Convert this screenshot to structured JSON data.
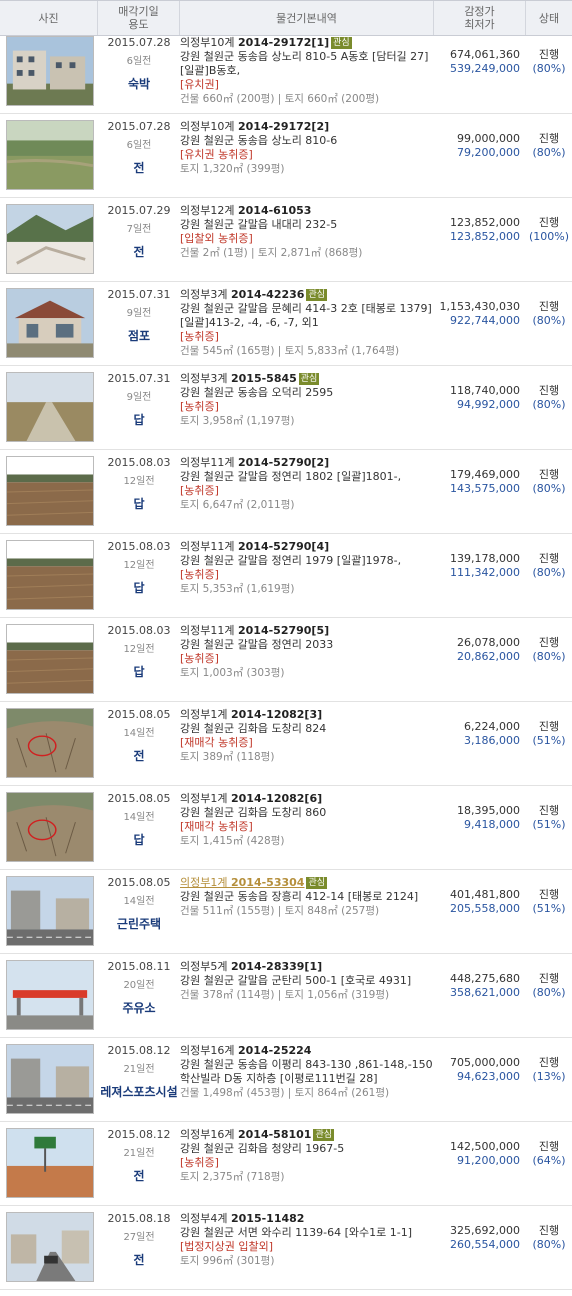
{
  "header": {
    "photo": "사진",
    "date_use": [
      "매각기일",
      "용도"
    ],
    "info": "물건기본내역",
    "price": [
      "감정가",
      "최저가"
    ],
    "status": "상태"
  },
  "rows": [
    {
      "date": "2015.07.28",
      "ago": "6일전",
      "use": "숙박",
      "court": "의정부10계",
      "case": "2014-29172[1]",
      "tag": "관심",
      "addr": "강원 철원군 동송읍 상노리 810-5 A동호 [담터길 27] [일괄]B동호,",
      "note": "[유치권]",
      "area": "건물 660㎡ (200평) | 토지 660㎡ (200평)",
      "appraisal": "674,061,360",
      "minimum": "539,249,000",
      "status": "진행",
      "pct": "(80%)",
      "img": "building"
    },
    {
      "date": "2015.07.28",
      "ago": "6일전",
      "use": "전",
      "court": "의정부10계",
      "case": "2014-29172[2]",
      "tag": "",
      "addr": "강원 철원군 동송읍 상노리 810-6",
      "note": "[유치권   농취증]",
      "area": "토지 1,320㎡ (399평)",
      "appraisal": "99,000,000",
      "minimum": "79,200,000",
      "status": "진행",
      "pct": "(80%)",
      "img": "field"
    },
    {
      "date": "2015.07.29",
      "ago": "7일전",
      "use": "전",
      "court": "의정부12계",
      "case": "2014-61053",
      "tag": "",
      "addr": "강원 철원군 갈말읍 내대리 232-5",
      "note": "[입찰외   농취증]",
      "area": "건물 2㎡ (1평) | 토지 2,871㎡ (868평)",
      "appraisal": "123,852,000",
      "minimum": "123,852,000",
      "status": "진행",
      "pct": "(100%)",
      "img": "snow"
    },
    {
      "date": "2015.07.31",
      "ago": "9일전",
      "use": "점포",
      "court": "의정부3계",
      "case": "2014-42236",
      "tag": "관심",
      "addr": "강원 철원군 갈말읍 문혜리 414-3 2호 [태봉로 1379] [일괄]413-2, -4, -6, -7, 외1",
      "note": "[농취증]",
      "area": "건물 545㎡ (165평) | 토지 5,833㎡ (1,764평)",
      "appraisal": "1,153,430,030",
      "minimum": "922,744,000",
      "status": "진행",
      "pct": "(80%)",
      "img": "shop"
    },
    {
      "date": "2015.07.31",
      "ago": "9일전",
      "use": "답",
      "court": "의정부3계",
      "case": "2015-5845",
      "tag": "관심",
      "addr": "강원 철원군 동송읍 오덕리 2595",
      "note": "[농취증]",
      "area": "토지 3,958㎡ (1,197평)",
      "appraisal": "118,740,000",
      "minimum": "94,992,000",
      "status": "진행",
      "pct": "(80%)",
      "img": "road"
    },
    {
      "date": "2015.08.03",
      "ago": "12일전",
      "use": "답",
      "court": "의정부11계",
      "case": "2014-52790[2]",
      "tag": "",
      "addr": "강원 철원군 갈말읍 정연리 1802 [일괄]1801-,",
      "note": "[농취증]",
      "area": "토지 6,647㎡ (2,011평)",
      "appraisal": "179,469,000",
      "minimum": "143,575,000",
      "status": "진행",
      "pct": "(80%)",
      "img": "paddy"
    },
    {
      "date": "2015.08.03",
      "ago": "12일전",
      "use": "답",
      "court": "의정부11계",
      "case": "2014-52790[4]",
      "tag": "",
      "addr": "강원 철원군 갈말읍 정연리 1979 [일괄]1978-,",
      "note": "[농취증]",
      "area": "토지 5,353㎡ (1,619평)",
      "appraisal": "139,178,000",
      "minimum": "111,342,000",
      "status": "진행",
      "pct": "(80%)",
      "img": "paddy"
    },
    {
      "date": "2015.08.03",
      "ago": "12일전",
      "use": "답",
      "court": "의정부11계",
      "case": "2014-52790[5]",
      "tag": "",
      "addr": "강원 철원군 갈말읍 정연리 2033",
      "note": "[농취증]",
      "area": "토지 1,003㎡ (303평)",
      "appraisal": "26,078,000",
      "minimum": "20,862,000",
      "status": "진행",
      "pct": "(80%)",
      "img": "paddy"
    },
    {
      "date": "2015.08.05",
      "ago": "14일전",
      "use": "전",
      "court": "의정부1계",
      "case": "2014-12082[3]",
      "tag": "",
      "addr": "강원 철원군 김화읍 도창리 824",
      "note": "[재매각   농취증]",
      "area": "토지 389㎡ (118평)",
      "appraisal": "6,224,000",
      "minimum": "3,186,000",
      "status": "진행",
      "pct": "(51%)",
      "img": "brush"
    },
    {
      "date": "2015.08.05",
      "ago": "14일전",
      "use": "답",
      "court": "의정부1계",
      "case": "2014-12082[6]",
      "tag": "",
      "addr": "강원 철원군 김화읍 도창리 860",
      "note": "[재매각   농취증]",
      "area": "토지 1,415㎡ (428평)",
      "appraisal": "18,395,000",
      "minimum": "9,418,000",
      "status": "진행",
      "pct": "(51%)",
      "img": "brush"
    },
    {
      "date": "2015.08.05",
      "ago": "14일전",
      "use": "근린주택",
      "court": "의정부1계",
      "case": "2014-53304",
      "tag": "관심",
      "link": true,
      "addr": "강원 철원군 동송읍 장흥리 412-14 [태봉로 2124]",
      "note": "",
      "area": "건물 511㎡ (155평) | 토지 848㎡ (257평)",
      "appraisal": "401,481,800",
      "minimum": "205,558,000",
      "status": "진행",
      "pct": "(51%)",
      "img": "street"
    },
    {
      "date": "2015.08.11",
      "ago": "20일전",
      "use": "주유소",
      "court": "의정부5계",
      "case": "2014-28339[1]",
      "tag": "",
      "addr": "강원 철원군 갈말읍 군탄리 500-1 [호국로 4931]",
      "note": "",
      "area": "건물 378㎡ (114평) | 토지 1,056㎡ (319평)",
      "appraisal": "448,275,680",
      "minimum": "358,621,000",
      "status": "진행",
      "pct": "(80%)",
      "img": "station"
    },
    {
      "date": "2015.08.12",
      "ago": "21일전",
      "use": "레져스포츠시설",
      "court": "의정부16계",
      "case": "2014-25224",
      "tag": "",
      "addr": "강원 철원군 동송읍 이평리 843-130 ,861-148,-150 학산빌라 D동 지하층 [이평로111번길 28]",
      "note": "",
      "area": "건물 1,498㎡ (453평) | 토지 864㎡ (261평)",
      "appraisal": "705,000,000",
      "minimum": "94,623,000",
      "status": "진행",
      "pct": "(13%)",
      "img": "street"
    },
    {
      "date": "2015.08.12",
      "ago": "21일전",
      "use": "전",
      "court": "의정부16계",
      "case": "2014-58101",
      "tag": "관심",
      "addr": "강원 철원군 김화읍 청양리 1967-5",
      "note": "[농취증]",
      "area": "토지 2,375㎡ (718평)",
      "appraisal": "142,500,000",
      "minimum": "91,200,000",
      "status": "진행",
      "pct": "(64%)",
      "img": "sign"
    },
    {
      "date": "2015.08.18",
      "ago": "27일전",
      "use": "전",
      "court": "의정부4계",
      "case": "2015-11482",
      "tag": "",
      "addr": "강원 철원군 서면 와수리 1139-64 [와수1로 1-1]",
      "note": "[법정지상권   입찰외]",
      "area": "토지 996㎡ (301평)",
      "appraisal": "325,692,000",
      "minimum": "260,554,000",
      "status": "진행",
      "pct": "(80%)",
      "img": "road2"
    }
  ],
  "colors": {
    "min_price": "#2a55a0",
    "note": "#c0392b",
    "use": "#1a3b7a",
    "tag": "#7a8b2c"
  }
}
